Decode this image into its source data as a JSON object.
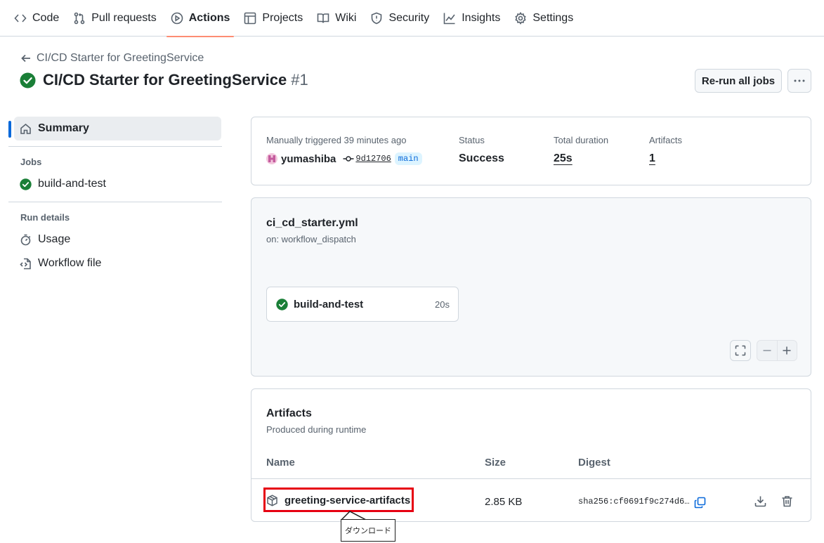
{
  "nav": {
    "tabs": [
      {
        "label": "Code",
        "icon": "code-icon"
      },
      {
        "label": "Pull requests",
        "icon": "git-pull-request-icon"
      },
      {
        "label": "Actions",
        "icon": "play-icon",
        "active": true
      },
      {
        "label": "Projects",
        "icon": "table-icon"
      },
      {
        "label": "Wiki",
        "icon": "book-icon"
      },
      {
        "label": "Security",
        "icon": "shield-icon"
      },
      {
        "label": "Insights",
        "icon": "graph-icon"
      },
      {
        "label": "Settings",
        "icon": "gear-icon"
      }
    ],
    "active_underline_color": "#fd8c73"
  },
  "header": {
    "back_link": "CI/CD Starter for GreetingService",
    "title": "CI/CD Starter for GreetingService",
    "run_number": "#1",
    "rerun_label": "Re-run all jobs",
    "more_label": "···"
  },
  "sidebar": {
    "summary": "Summary",
    "jobs_heading": "Jobs",
    "jobs": [
      {
        "label": "build-and-test",
        "status": "success"
      }
    ],
    "run_details_heading": "Run details",
    "usage": "Usage",
    "workflow_file": "Workflow file"
  },
  "summary": {
    "trigger_label": "Manually triggered 39 minutes ago",
    "actor": "yumashiba",
    "commit_sha": "9d12706",
    "branch": "main",
    "status_label": "Status",
    "status_value": "Success",
    "duration_label": "Total duration",
    "duration_value": "25s",
    "artifacts_label": "Artifacts",
    "artifacts_value": "1"
  },
  "workflow": {
    "file": "ci_cd_starter.yml",
    "trigger": "on: workflow_dispatch",
    "job_name": "build-and-test",
    "job_duration": "20s",
    "zoom_out": "−",
    "zoom_in": "+"
  },
  "artifacts": {
    "title": "Artifacts",
    "subtitle": "Produced during runtime",
    "col_name": "Name",
    "col_size": "Size",
    "col_digest": "Digest",
    "rows": [
      {
        "name": "greeting-service-artifacts",
        "size": "2.85 KB",
        "digest": "sha256:cf0691f9c274d6…"
      }
    ]
  },
  "annotation": {
    "callout_text": "ダウンロード",
    "highlight_color": "#e60012"
  },
  "colors": {
    "success": "#1a7f37",
    "accent": "#0969da",
    "border": "#d0d7de",
    "muted": "#59636e"
  }
}
